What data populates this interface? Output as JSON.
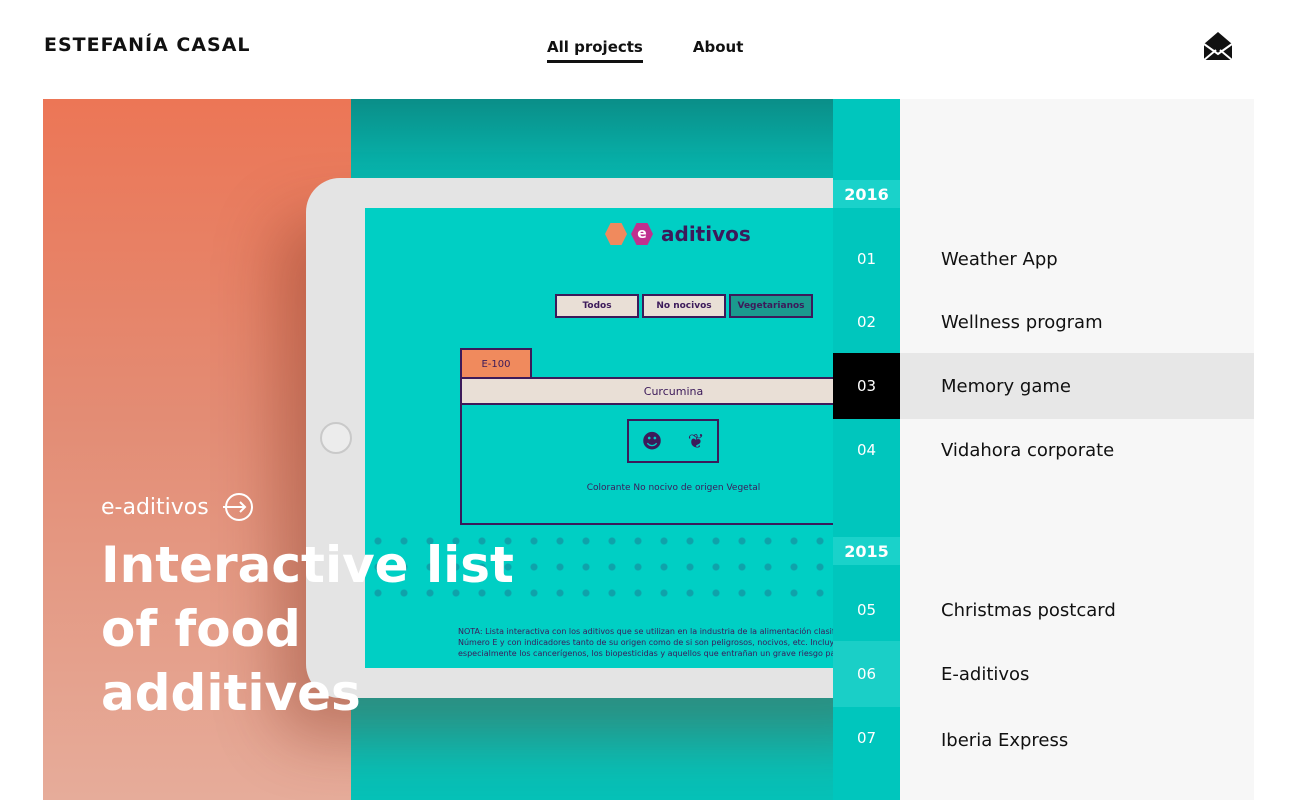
{
  "header": {
    "brand": "ESTEFANÍA CASAL",
    "nav": [
      {
        "label": "All projects",
        "active": true
      },
      {
        "label": "About",
        "active": false
      }
    ],
    "mail_icon": "envelope-icon"
  },
  "hero": {
    "kicker": "e-aditivos",
    "kicker_icon": "arrow-circle-right-icon",
    "title": "Interactive list of food additives",
    "colors": {
      "gradient_top": "#ec7656",
      "gradient_bottom": "#e6ac9a",
      "teal": "#00c6bd"
    },
    "mockup": {
      "logo": "aditivos",
      "logo_letter": "e",
      "tabs": [
        "Todos",
        "No nocivos",
        "Vegetarianos"
      ],
      "code": "E-100",
      "name": "Curcumina",
      "description": "Colorante No nocivo de origen Vegetal",
      "note": "NOTA: Lista interactiva con los aditivos que se utilizan en la industria de la alimentación clasificados por su Número E y con indicadores tanto de su origen como de si son peligrosos, nocivos, etc. Incluye especialmente los cancerígenos, los biopesticidas y aquellos que entrañan un grave riesgo para la salud."
    }
  },
  "timeline": {
    "years": [
      "2016",
      "2015"
    ],
    "numbers": [
      "01",
      "02",
      "03",
      "04",
      "05",
      "06",
      "07"
    ]
  },
  "projects": [
    {
      "num": "01",
      "label": "Weather App"
    },
    {
      "num": "02",
      "label": "Wellness program"
    },
    {
      "num": "03",
      "label": "Memory game",
      "active": true
    },
    {
      "num": "04",
      "label": "Vidahora corporate"
    },
    {
      "num": "05",
      "label": "Christmas postcard"
    },
    {
      "num": "06",
      "label": "E-aditivos"
    },
    {
      "num": "07",
      "label": "Iberia Express"
    }
  ]
}
